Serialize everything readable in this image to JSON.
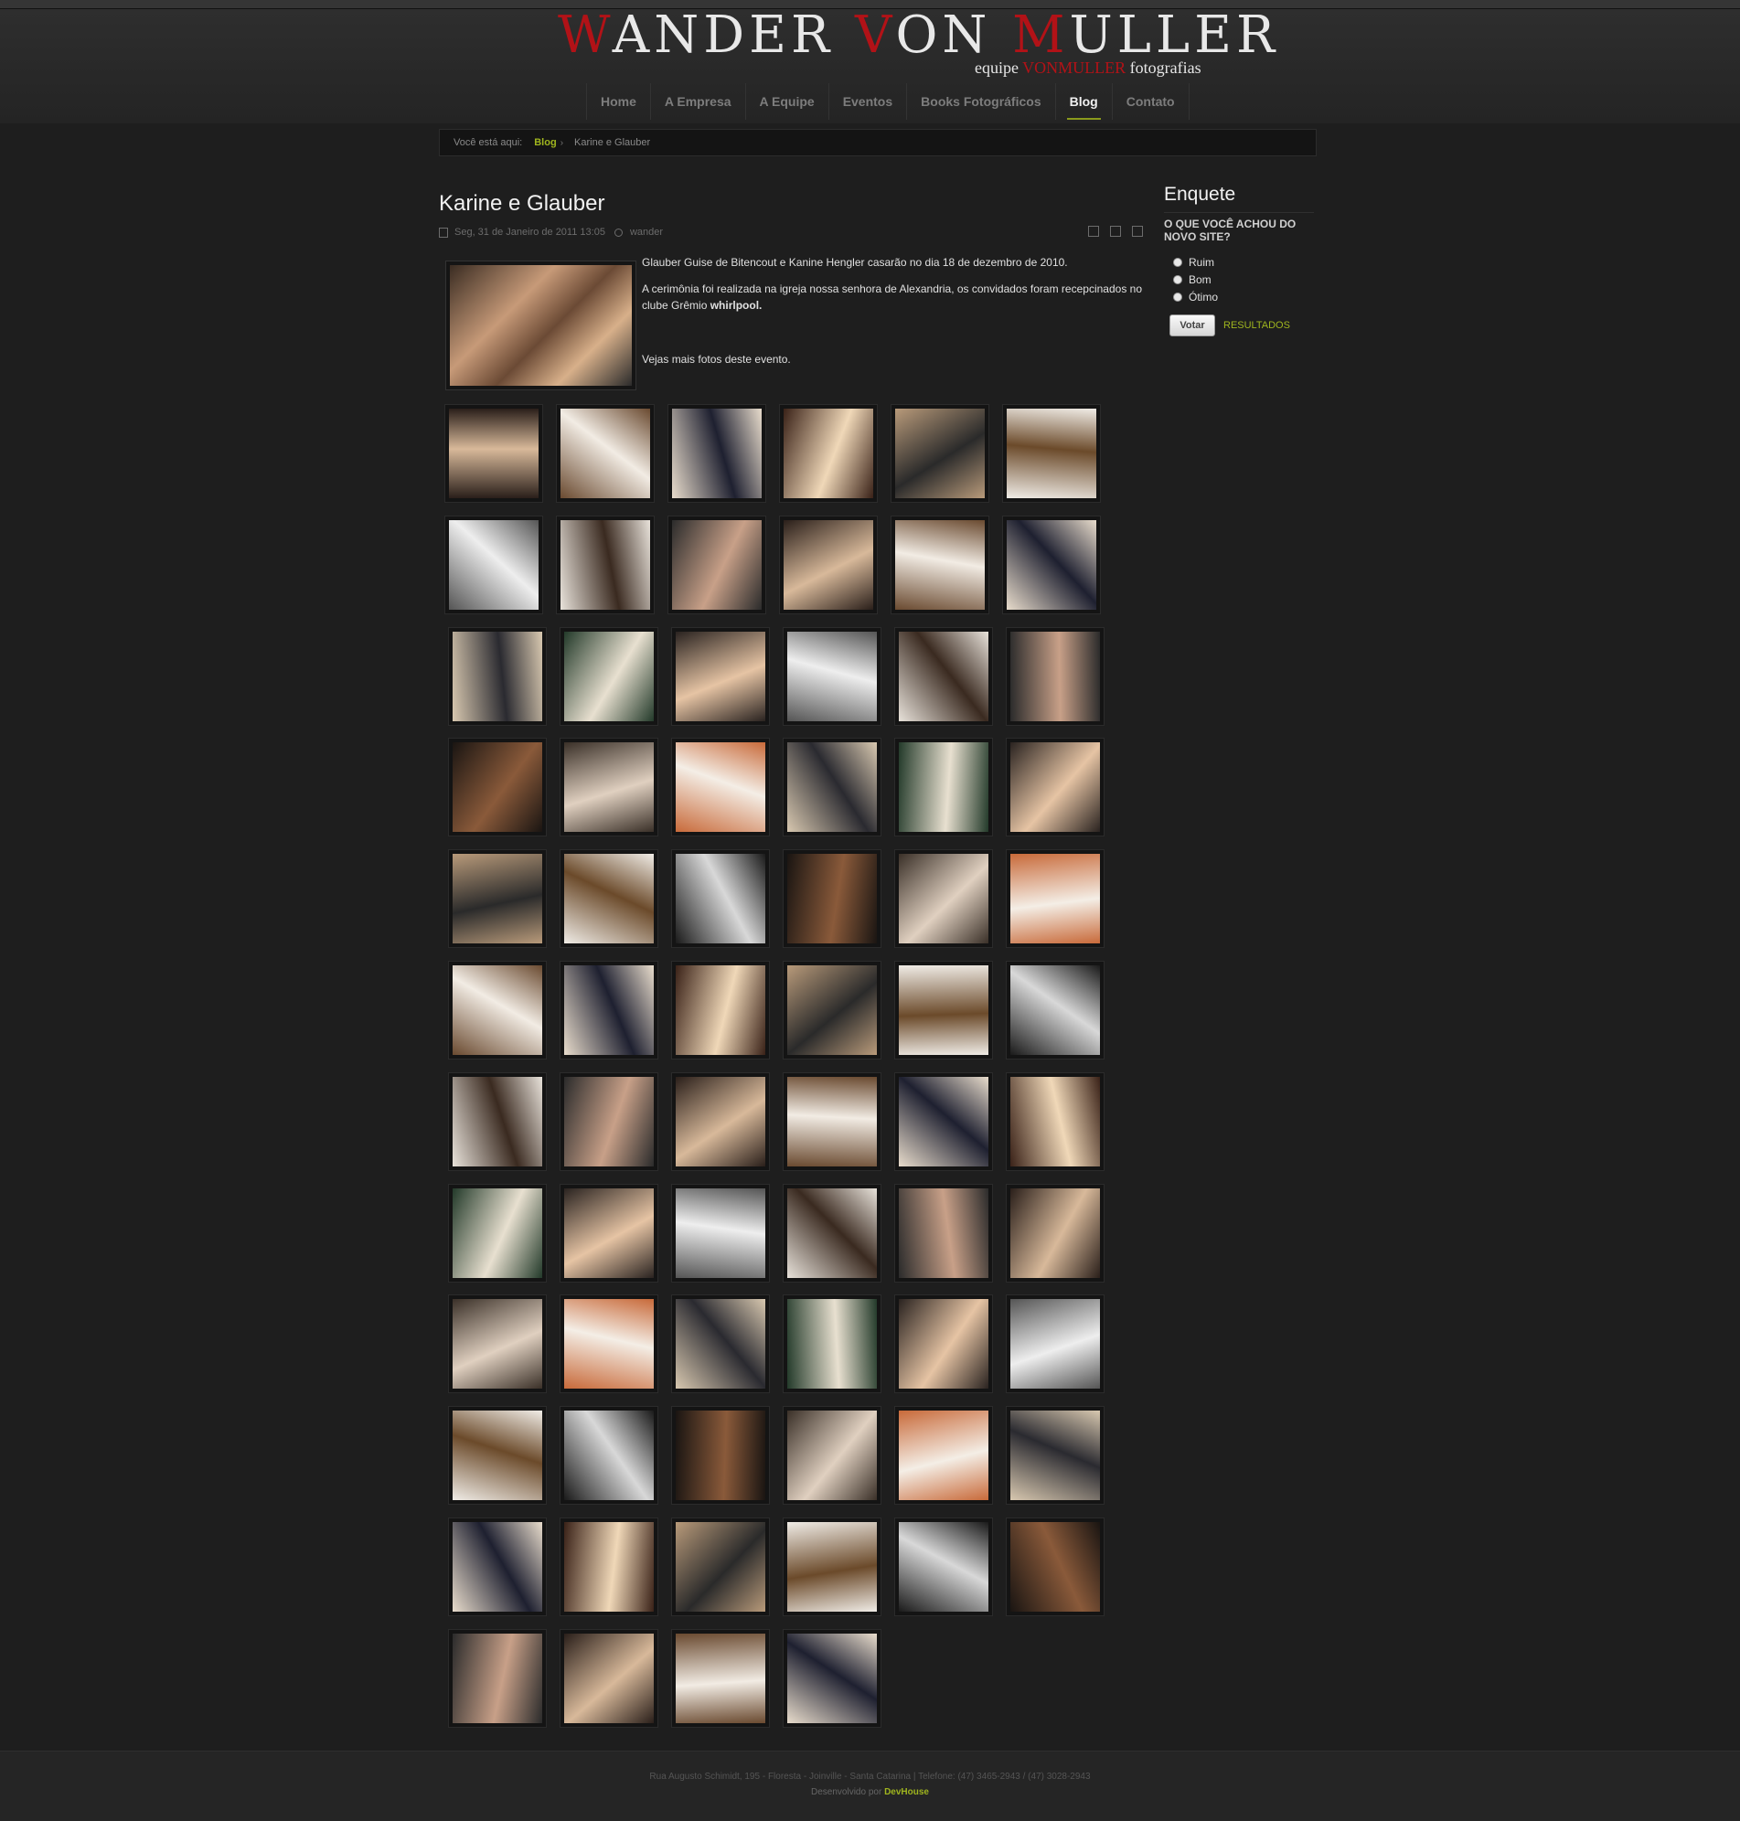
{
  "header": {
    "logo": {
      "w": "W",
      "ander": "ANDER ",
      "v": "V",
      "on": "ON ",
      "m": "M",
      "uller": "ULLER"
    },
    "tagline": {
      "pre": "equipe ",
      "brand": "VONMULLER",
      "post": " fotografias"
    }
  },
  "nav": [
    "Home",
    "A Empresa",
    "A Equipe",
    "Eventos",
    "Books Fotográficos",
    "Blog",
    "Contato"
  ],
  "breadcrumb": {
    "label": "Você está aqui:",
    "link": "Blog",
    "current": "Karine e Glauber"
  },
  "article": {
    "title": "Karine e Glauber",
    "date": "Seg, 31 de Janeiro de 2011 13:05",
    "author": "wander",
    "p1": "Glauber Guise de Bitencout e Kanine Hengler casarão no dia 18 de dezembro de 2010.",
    "p2_start": "A cerimônia foi realizada na igreja nossa senhora de Alexandria, os convidados foram recepcinados no clube Grêmio ",
    "p2_bold": "whirlpool.",
    "p3": "Vejas mais fotos deste evento."
  },
  "poll": {
    "heading": "Enquete",
    "question": "O QUE VOCÊ ACHOU DO NOVO SITE?",
    "options": [
      "Ruim",
      "Bom",
      "Ótimo"
    ],
    "vote_label": "Votar",
    "results_label": "RESULTADOS"
  },
  "footer": {
    "address": "Rua Augusto Schimidt, 195 - Floresta - Joinville - Santa Catarina | Telefone: (47) 3465-2943 / (47) 3028-2943",
    "dev_prefix": "Desenvolvido por ",
    "dev_name": "DevHouse"
  },
  "gallery": {
    "count": 70,
    "palettes": [
      [
        "#2a1f1a",
        "#d8b99a"
      ],
      [
        "#1a1512",
        "#8a5a3a"
      ],
      [
        "#e8e2da",
        "#3a2a20"
      ],
      [
        "#f0ece6",
        "#6b4a2a"
      ],
      [
        "#2a2320",
        "#e6c4a4"
      ],
      [
        "#3a2218",
        "#f0d8b8"
      ],
      [
        "#d8c8b0",
        "#2a2a30"
      ],
      [
        "#6a4a30",
        "#f2ece4"
      ],
      [
        "#3a3028",
        "#e0d0c0"
      ],
      [
        "#2b2b2b",
        "#c8a088"
      ],
      [
        "#1a1a1a",
        "#d8d8d8"
      ],
      [
        "#555555",
        "#eeeeee"
      ],
      [
        "#b89a7a",
        "#2a2a2a"
      ],
      [
        "#233a2a",
        "#e8e0d0"
      ],
      [
        "#e8dccc",
        "#1e2030"
      ],
      [
        "#c86a3a",
        "#f4eee6"
      ]
    ]
  }
}
